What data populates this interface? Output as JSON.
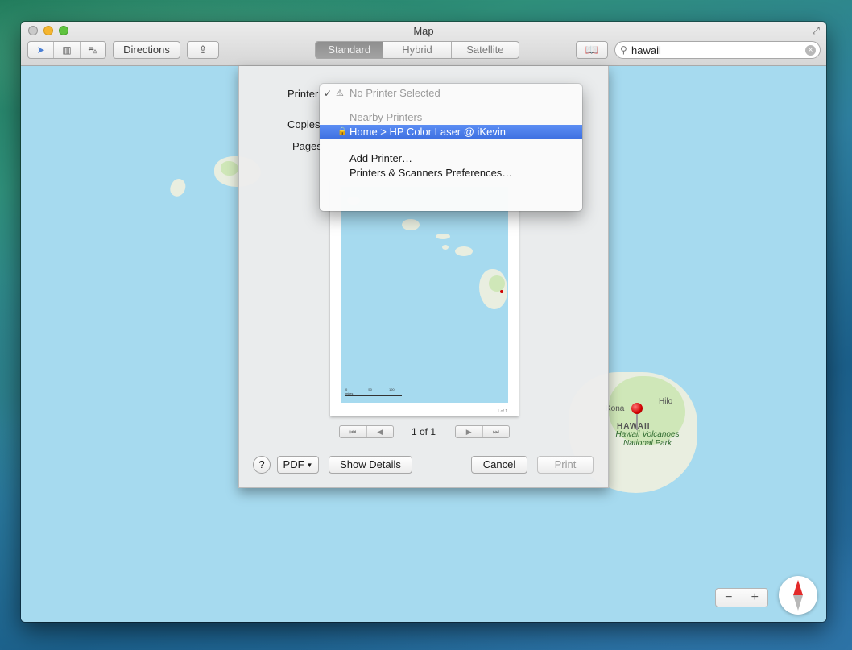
{
  "window": {
    "title": "Map"
  },
  "toolbar": {
    "directions_label": "Directions",
    "modes": [
      "Standard",
      "Hybrid",
      "Satellite"
    ],
    "active_mode": "Standard",
    "search": {
      "value": "hawaii",
      "placeholder": ""
    }
  },
  "map": {
    "labels": {
      "kona": "Kona",
      "hilo": "Hilo",
      "hawaii": "HAWAII",
      "park": "Hawaii Volcanoes National Park"
    },
    "zoom": {
      "minus": "−",
      "plus": "+"
    }
  },
  "print_sheet": {
    "printer_label": "Printer",
    "copies_label": "Copies",
    "pages_label": "Pages",
    "preview_page_count": "1 of 1",
    "preview_small_count": "1 of 1",
    "page_label": "1 of 1",
    "help_label": "?",
    "pdf_label": "PDF",
    "show_details_label": "Show Details",
    "cancel_label": "Cancel",
    "print_label": "Print",
    "scale_labels": [
      "0",
      "50",
      "100 miles"
    ]
  },
  "printer_menu": {
    "items": [
      {
        "label": "No Printer Selected",
        "checked": true,
        "state": "disabled"
      },
      {
        "label": "Nearby Printers",
        "state": "header"
      },
      {
        "label": "Home > HP Color Laser @ iKevin",
        "state": "selected"
      },
      {
        "label": "Add Printer…",
        "state": "normal"
      },
      {
        "label": "Printers & Scanners Preferences…",
        "state": "normal"
      }
    ]
  },
  "colors": {
    "ocean": "#a6daef",
    "land": "#e9eee0",
    "park_green": "#cfe7b8",
    "menu_highlight": "#3d6fe0",
    "pin_red": "#d10000"
  }
}
